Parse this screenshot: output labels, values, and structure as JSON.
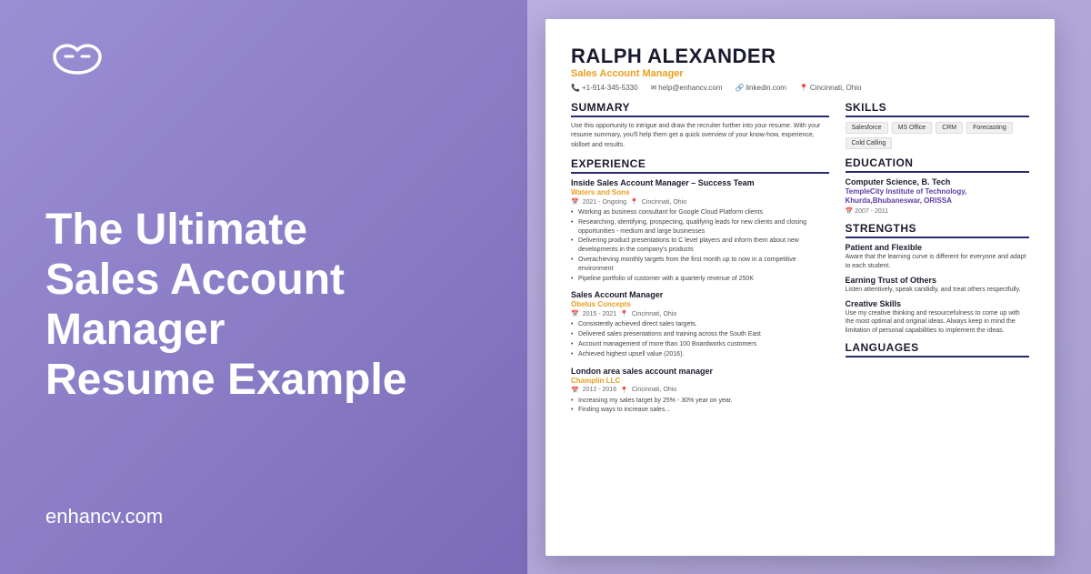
{
  "left": {
    "logo_alt": "enhancv logo",
    "headline_line1": "The Ultimate",
    "headline_line2": "Sales Account",
    "headline_line3": "Manager",
    "headline_line4": "Resume Example",
    "site_url": "enhancv.com"
  },
  "resume": {
    "name": "RALPH ALEXANDER",
    "title": "Sales Account Manager",
    "phone": "+1-914-345-5330",
    "email": "help@enhancv.com",
    "linkedin": "linkedin.com",
    "location": "Cincinnati, Ohio",
    "summary_title": "SUMMARY",
    "summary_text": "Use this opportunity to intrigue and draw the recruiter further into your resume. With your resume summary, you'll help them get a quick overview of your know-how, experience, skillset and results.",
    "experience_title": "EXPERIENCE",
    "jobs": [
      {
        "title": "Inside Sales Account Manager – Success Team",
        "company": "Waters and Sons",
        "period": "2021 - Ongoing",
        "location": "Cincinnati, Ohio",
        "bullets": [
          "Working as business consultant for Google Cloud Platform clients",
          "Researching, identifying, prospecting, qualifying leads for new clients and closing opportunities - medium and large businesses",
          "Delivering product presentations to C level players and inform them about new developments in the company's products",
          "Overachieving monthly targets from the first month up to now in a competitive environment",
          "Pipeline portfolio of customer with a quarterly revenue of 250K"
        ]
      },
      {
        "title": "Sales Account Manager",
        "company": "Obelus Concepts",
        "period": "2015 - 2021",
        "location": "Cincinnati, Ohio",
        "bullets": [
          "Consistently achieved direct sales targets.",
          "Delivered sales presentations and training across the South East",
          "Account management of more than 100 Boardworks customers",
          "Achieved highest upsell value (2016)."
        ]
      },
      {
        "title": "London area sales account manager",
        "company": "Champlin LLC",
        "period": "2012 - 2016",
        "location": "Cincinnati, Ohio",
        "bullets": [
          "Increasing my sales target by 25% - 30% year on year.",
          "Finding ways to increase sales..."
        ]
      }
    ],
    "skills_title": "SKILLS",
    "skills": [
      "Salesforce",
      "MS Office",
      "CRM",
      "Forecasting",
      "Cold Calling"
    ],
    "education_title": "EDUCATION",
    "education": [
      {
        "degree": "Computer Science, B. Tech",
        "school": "TempleCity Institute of Technology, Khurda,Bhubaneswar, ORISSA",
        "years": "2007 - 2011"
      }
    ],
    "strengths_title": "STRENGTHS",
    "strengths": [
      {
        "title": "Patient and Flexible",
        "text": "Aware that the learning curve is different for everyone and adapt to each student."
      },
      {
        "title": "Earning Trust of Others",
        "text": "Listen attentively, speak candidly, and treat others respectfully."
      },
      {
        "title": "Creative Skills",
        "text": "Use my creative thinking and resourcefulness to come up with the most optimal and original ideas. Always keep in mind the limitation of personal capabilities to implement the ideas."
      }
    ],
    "languages_title": "LANGUAGES"
  }
}
